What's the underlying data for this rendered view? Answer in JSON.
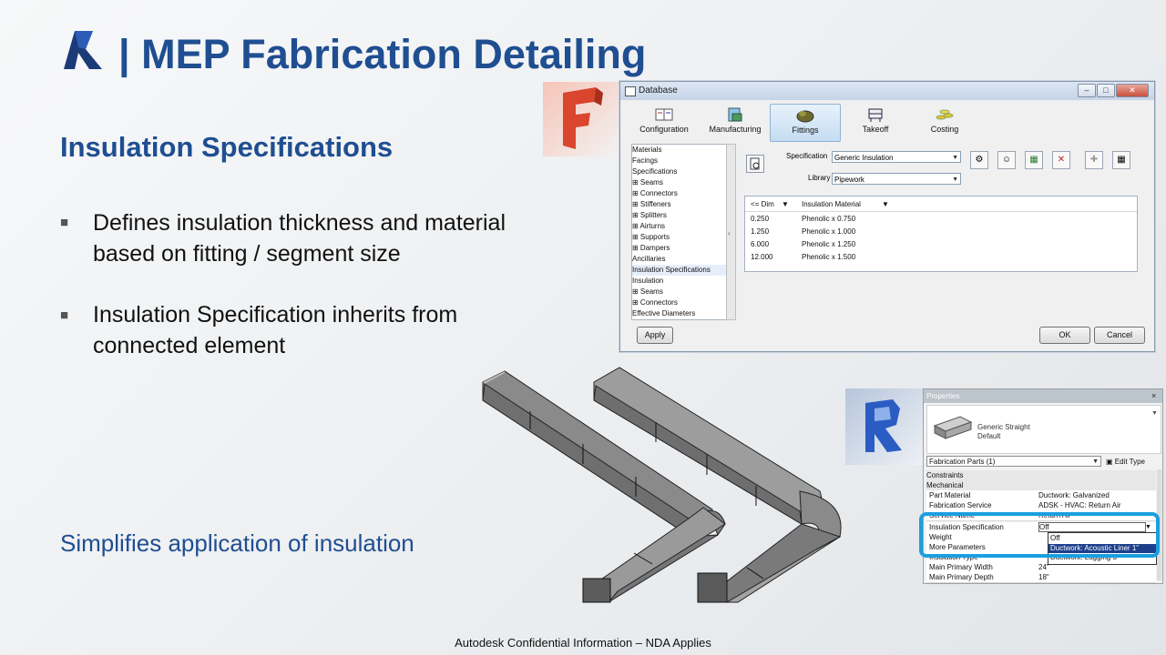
{
  "header": {
    "title": "| MEP Fabrication Detailing"
  },
  "section_title": "Insulation Specifications",
  "bullets": [
    {
      "line1": "Defines insulation thickness and material",
      "line2": "based on fitting / segment size"
    },
    {
      "line1": "Insulation Specification inherits from",
      "line2": "connected element"
    }
  ],
  "summary": "Simplifies application of insulation",
  "footer": "Autodesk Confidential Information – NDA Applies",
  "database_dialog": {
    "title": "Database",
    "toolbar": [
      "Configuration",
      "Manufacturing",
      "Fittings",
      "Takeoff",
      "Costing"
    ],
    "active_tab": "Fittings",
    "tree": [
      "Materials",
      "  Facings",
      "Specifications",
      "  ⊞ Seams",
      "  ⊞ Connectors",
      "  ⊞ Stiffeners",
      "  ⊞ Splitters",
      "  ⊞ Airturns",
      "  ⊞ Supports",
      "  ⊞ Dampers",
      "Ancillaries",
      "Insulation Specifications",
      "  Insulation",
      "  ⊞ Seams",
      "  ⊞ Connectors",
      "Effective Diameters"
    ],
    "specification_label": "Specification",
    "specification_value": "Generic Insulation",
    "library_label": "Library",
    "library_value": "Pipework",
    "grid_headers": [
      "<= Dim",
      "Insulation Material"
    ],
    "grid_rows": [
      [
        "0.250",
        "Phenolic x 0.750"
      ],
      [
        "1.250",
        "Phenolic x 1.000"
      ],
      [
        "6.000",
        "Phenolic x 1.250"
      ],
      [
        "12.000",
        "Phenolic x 1.500"
      ]
    ],
    "apply_label": "Apply",
    "ok_label": "OK",
    "cancel_label": "Cancel"
  },
  "properties_panel": {
    "title": "Properties",
    "close": "×",
    "type_name_line1": "Generic Straight",
    "type_name_line2": "Default",
    "selector": "Fabrication Parts (1)",
    "edit_type": "Edit Type",
    "rows": [
      {
        "kind": "section",
        "label": "Constraints"
      },
      {
        "kind": "section",
        "label": "Mechanical"
      },
      {
        "kind": "row",
        "label": "Part Material",
        "value": "Ductwork: Galvanized"
      },
      {
        "kind": "row",
        "label": "Fabrication Service",
        "value": "ADSK - HVAC: Return Air"
      },
      {
        "kind": "row",
        "label": "Service Name",
        "value": "Return Air"
      },
      {
        "kind": "row",
        "label": "Insulation Specification",
        "value": "Off"
      },
      {
        "kind": "row",
        "label": "Weight",
        "value": ""
      },
      {
        "kind": "row",
        "label": "More Parameters",
        "value": ""
      },
      {
        "kind": "row",
        "label": "Insulation Type",
        "value": ""
      },
      {
        "kind": "row",
        "label": "Main Primary Width",
        "value": "24\""
      },
      {
        "kind": "row",
        "label": "Main Primary Depth",
        "value": "18\""
      }
    ],
    "dropdown_options": [
      "Off",
      "Ductwork: Acoustic Liner 1\"",
      "Ductwork: Lagging 3\""
    ]
  },
  "colors": {
    "title": "#1f4e91",
    "highlight": "#1a9fe0",
    "fab_red": "#d9452d",
    "revit_blue": "#2a5cc4"
  }
}
